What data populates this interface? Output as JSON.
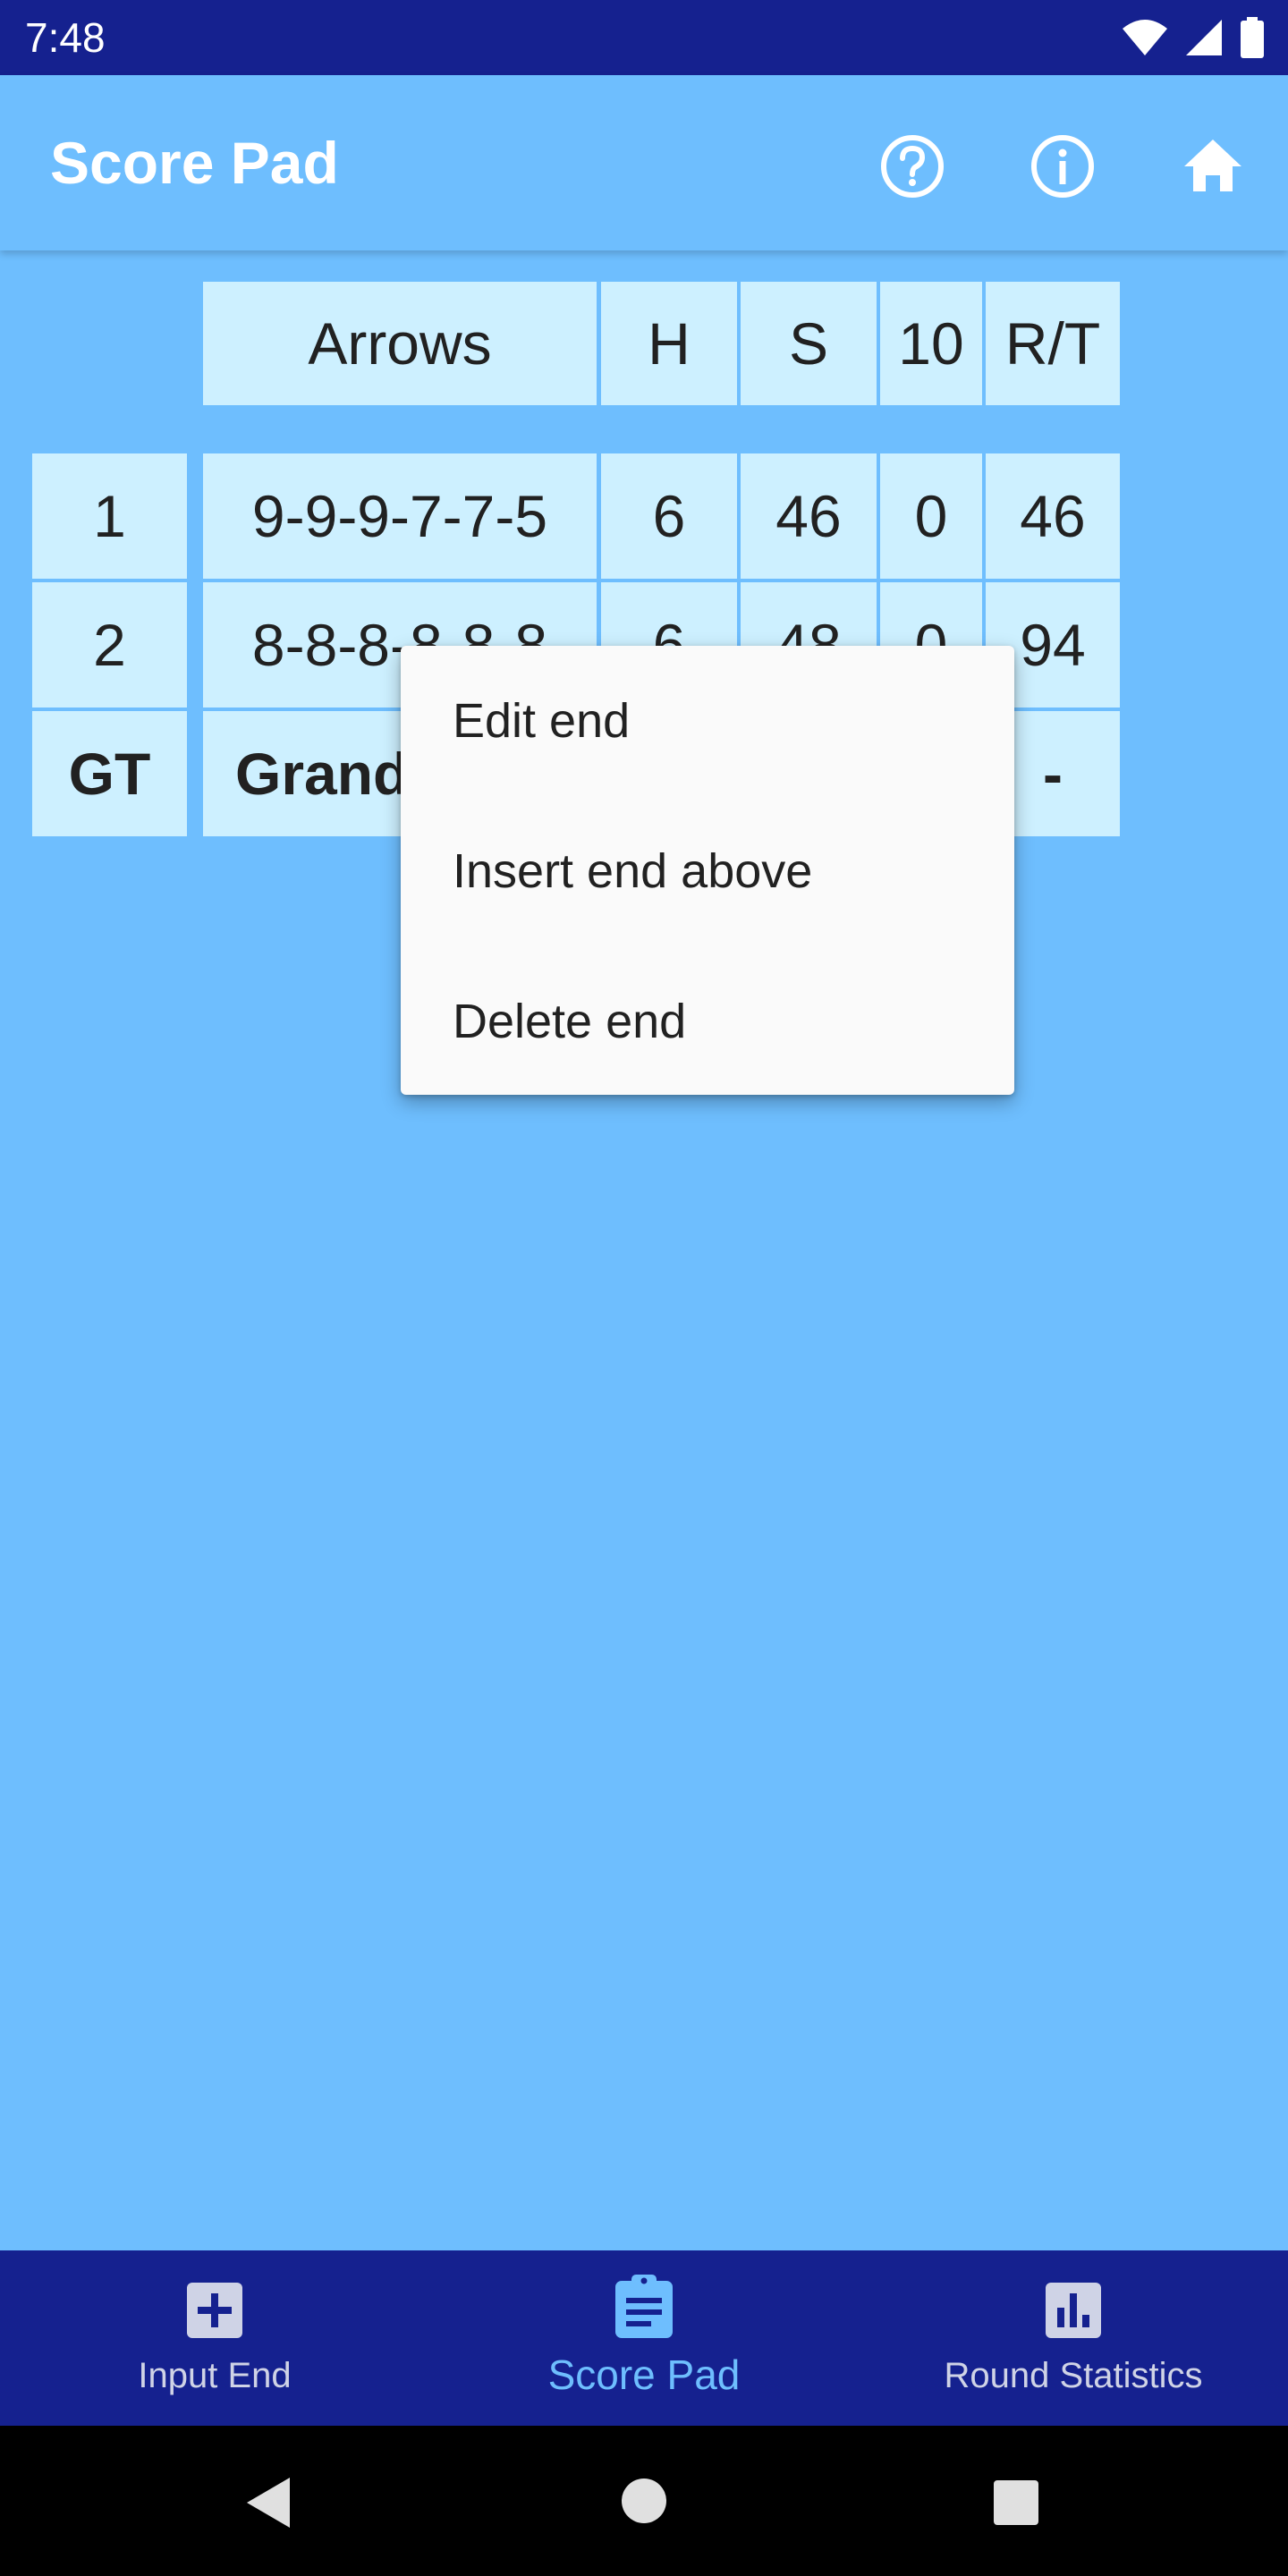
{
  "status_bar": {
    "time": "7:48",
    "icons": [
      "wifi-icon",
      "cellular-signal-icon",
      "battery-icon"
    ]
  },
  "app_bar": {
    "title": "Score Pad",
    "actions": [
      {
        "name": "help-icon",
        "label": "help"
      },
      {
        "name": "info-icon",
        "label": "info"
      },
      {
        "name": "home-icon",
        "label": "home"
      }
    ]
  },
  "table": {
    "headers": [
      "Arrows",
      "H",
      "S",
      "10",
      "R/T"
    ],
    "rows": [
      {
        "end": "1",
        "arrows": "9-9-9-7-7-5",
        "h": "6",
        "s": "46",
        "ten": "0",
        "rt": "46"
      },
      {
        "end": "2",
        "arrows": "8-8-8-8-8-8",
        "h": "6",
        "s": "48",
        "ten": "0",
        "rt": "94"
      }
    ],
    "total_row": {
      "end": "GT",
      "arrows": "Grand",
      "rt": "-"
    }
  },
  "context_menu": {
    "items": [
      "Edit end",
      "Insert end above",
      "Delete end"
    ]
  },
  "bottom_nav": {
    "items": [
      {
        "label": "Input End",
        "icon": "add-box-icon",
        "active": false
      },
      {
        "label": "Score Pad",
        "icon": "clipboard-list-icon",
        "active": true
      },
      {
        "label": "Round Statistics",
        "icon": "bar-chart-icon",
        "active": false
      }
    ]
  },
  "colors": {
    "background": "#6ebefe",
    "status_bar": "#15218f",
    "bottom_nav": "#15218f",
    "table_cell": "#cdf0ff",
    "nav_active": "#6ebefe",
    "nav_inactive": "#cfd3e6",
    "menu_background": "#fafafa"
  }
}
